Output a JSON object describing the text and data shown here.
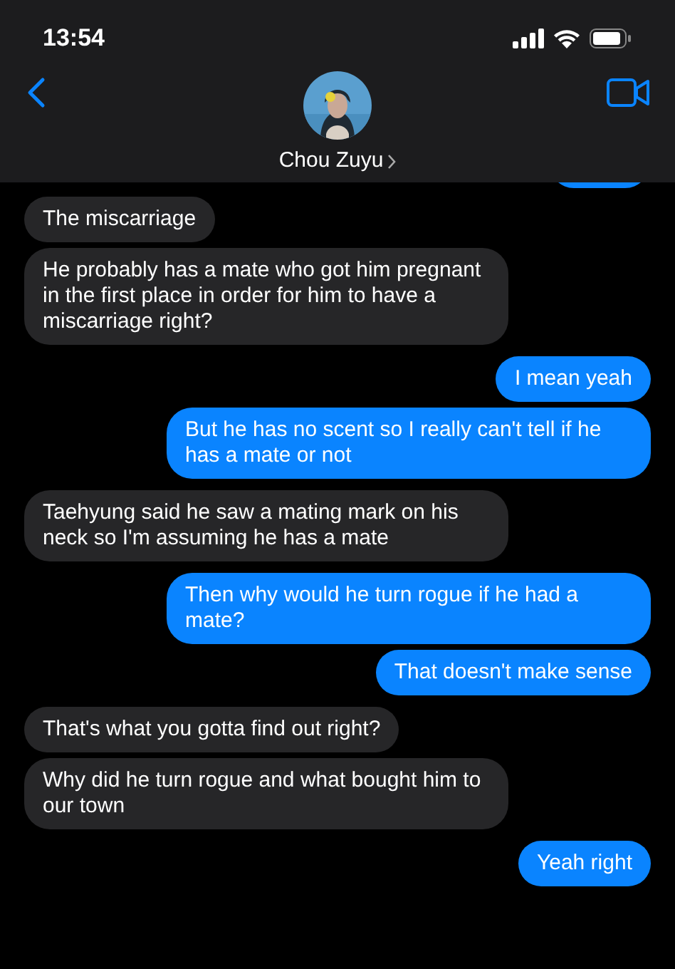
{
  "status_bar": {
    "time": "13:54"
  },
  "contact": {
    "name": "Chou Zuyu"
  },
  "messages": [
    {
      "kind": "incoming",
      "text": "The miscarriage"
    },
    {
      "kind": "incoming",
      "text": "He probably has a mate who got him pregnant in the first place in order for him to have a miscarriage right?"
    },
    {
      "kind": "outgoing",
      "text": "I mean yeah"
    },
    {
      "kind": "outgoing",
      "text": "But he has no scent so I really can't tell if he has a mate or not"
    },
    {
      "kind": "incoming",
      "text": "Taehyung said he saw a mating mark on his neck so I'm assuming he has a mate"
    },
    {
      "kind": "outgoing",
      "text": "Then why would he turn rogue if he had a mate?"
    },
    {
      "kind": "outgoing",
      "text": "That doesn't make sense"
    },
    {
      "kind": "incoming",
      "text": "That's what you gotta find out right?"
    },
    {
      "kind": "incoming",
      "text": "Why did he turn rogue and what bought him to our town"
    },
    {
      "kind": "outgoing",
      "text": "Yeah right"
    }
  ]
}
